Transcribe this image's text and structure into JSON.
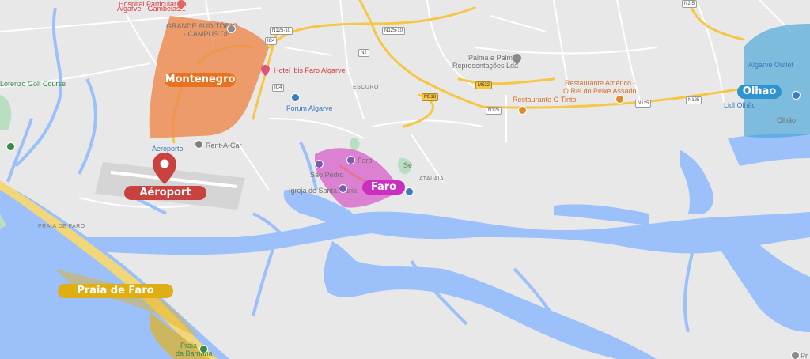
{
  "map": {
    "labels": {
      "hospital_top": "Hospital Particular do",
      "hospital_sub": "Algarve - Gambelas...",
      "grande_auditorio_1": "GRANDE AUDITÓRIO",
      "grande_auditorio_2": "- CAMPUS DE...",
      "lorenzo": "Lorenzo Golf Course",
      "hotel_ibis": "Hotel ibis Faro Algarve",
      "escuro": "ESCURO",
      "forum": "Forum Algarve",
      "palma_1": "Palma e Palma",
      "palma_2": "Representações Lda",
      "americo_1": "Restaurante Américo -",
      "americo_2": "O Rei do Peixe Assado",
      "tintol": "Restaurante O Tintol",
      "algarve_outlet": "Algarve Outlet",
      "lidl": "Lidl Olhão",
      "olhao_small": "Olhão",
      "aeroporto": "Aeroporto",
      "rentacar": "Rent-A-Car",
      "faro_city": "Faro",
      "se": "Sé",
      "sao_pedro": "São Pedro",
      "igreja": "Igreja de Santa Maria",
      "atalaia": "ATALAIA",
      "praia_faro_small": "PRAIA DE FARO",
      "praia_barrinha_1": "Praia",
      "praia_barrinha_2": "da Barrinha",
      "praia_bottom": "Pr"
    },
    "roads": {
      "n125_10a": "N125-10",
      "n125_10b": "N125-10",
      "ic4a": "IC4",
      "ic4b": "IC4",
      "n2": "N2",
      "m522": "M522",
      "m518": "M518",
      "n125a": "N125",
      "n125b": "N125",
      "n125c": "N125",
      "n25": "N2-5"
    },
    "zones": {
      "montenegro": "Montenegro",
      "aeroport": "Aéroport",
      "faro": "Faro",
      "olhao": "Olhao",
      "praia_de_faro": "Praia de Faro"
    },
    "colors": {
      "land": "#e8e8e8",
      "water": "#9cc0f9",
      "major_road": "#f6c644",
      "montenegro": "#ee8a4e",
      "aeroport": "#c8423f",
      "faro": "#d540c4",
      "olhao": "#3ea1d8",
      "praia_de_faro": "#e2b21c"
    }
  }
}
